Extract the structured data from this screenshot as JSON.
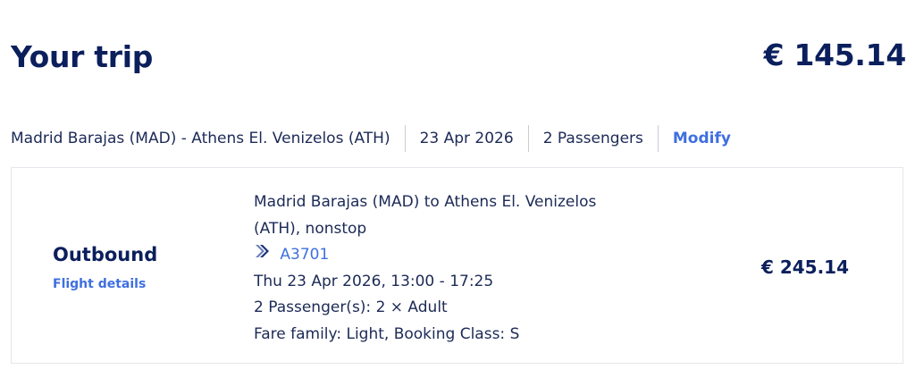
{
  "header": {
    "title": "Your trip",
    "total_price": "€ 145.14"
  },
  "summary": {
    "route": "Madrid Barajas (MAD) - Athens El. Venizelos (ATH)",
    "date": "23 Apr 2026",
    "passengers": "2 Passengers",
    "modify_label": "Modify"
  },
  "flight": {
    "direction": "Outbound",
    "details_link": "Flight details",
    "route_line1": "Madrid Barajas (MAD) to Athens El. Venizelos",
    "route_line2": "(ATH), nonstop",
    "airline_icon": "aegean-chevron-icon",
    "flight_number": "A3701",
    "datetime": "Thu 23 Apr 2026, 13:00 - 17:25",
    "passengers": "2 Passenger(s): 2 × Adult",
    "fare": "Fare family: Light, Booking Class: S",
    "price": "€ 245.14"
  },
  "colors": {
    "navy": "#0b1f5c",
    "link_blue": "#3f6fe0",
    "border": "#e4e6ec"
  }
}
